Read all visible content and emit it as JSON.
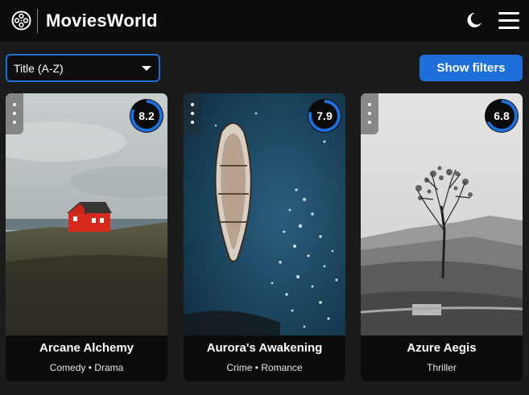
{
  "header": {
    "brand": "MoviesWorld",
    "logo_icon": "film-reel-icon",
    "theme_icon": "moon-icon",
    "menu_icon": "hamburger-menu-icon"
  },
  "toolbar": {
    "sort_value": "Title (A-Z)",
    "filters_label": "Show filters",
    "accent_color": "#1e6fd9"
  },
  "movies": [
    {
      "title": "Arcane Alchemy",
      "genres": "Comedy • Drama",
      "rating": "8.2",
      "rating_fraction": 0.82
    },
    {
      "title": "Aurora's Awakening",
      "genres": "Crime • Romance",
      "rating": "7.9",
      "rating_fraction": 0.79
    },
    {
      "title": "Azure Aegis",
      "genres": "Thriller",
      "rating": "6.8",
      "rating_fraction": 0.68
    }
  ]
}
